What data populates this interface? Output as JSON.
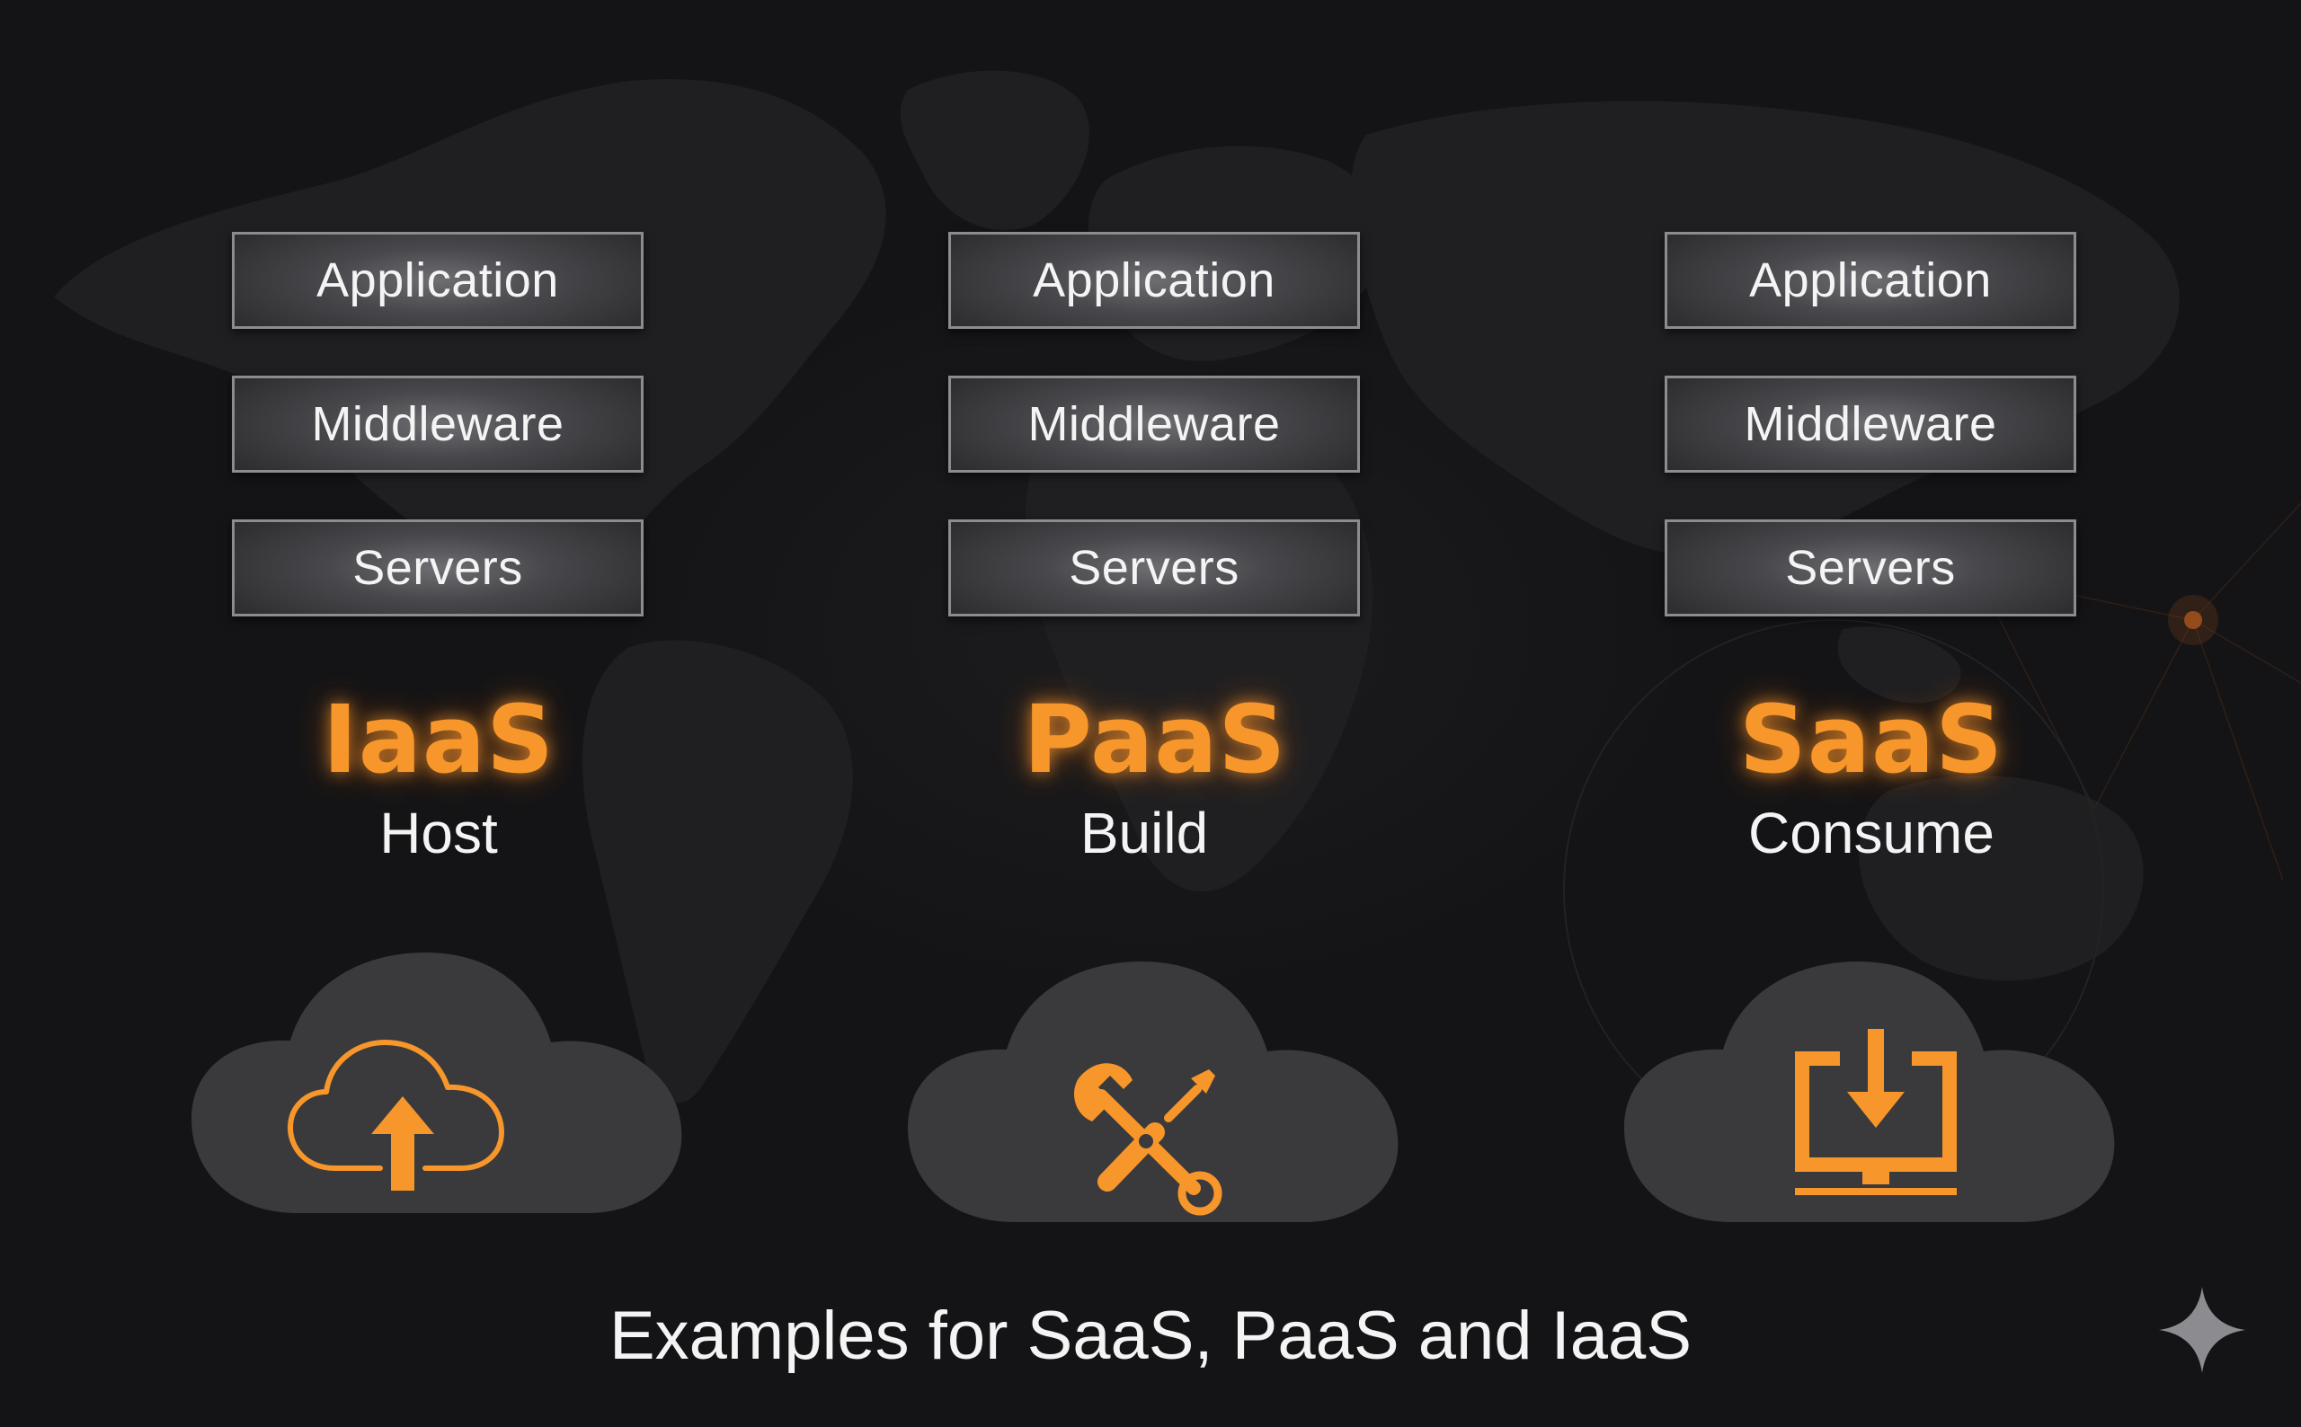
{
  "columns": [
    {
      "layers": [
        "Application",
        "Middleware",
        "Servers"
      ],
      "model": "IaaS",
      "verb": "Host",
      "icon": "cloud-upload-icon"
    },
    {
      "layers": [
        "Application",
        "Middleware",
        "Servers"
      ],
      "model": "PaaS",
      "verb": "Build",
      "icon": "wrench-screwdriver-icon"
    },
    {
      "layers": [
        "Application",
        "Middleware",
        "Servers"
      ],
      "model": "SaaS",
      "verb": "Consume",
      "icon": "monitor-download-icon"
    }
  ],
  "caption": "Examples for SaaS, PaaS and IaaS",
  "colors": {
    "background": "#141416",
    "accent": "#f7962b",
    "cloud": "#3a3a3c",
    "box_border": "#8c8c90",
    "text": "#f4f4f4"
  },
  "corner_mark": "sparkle-icon"
}
